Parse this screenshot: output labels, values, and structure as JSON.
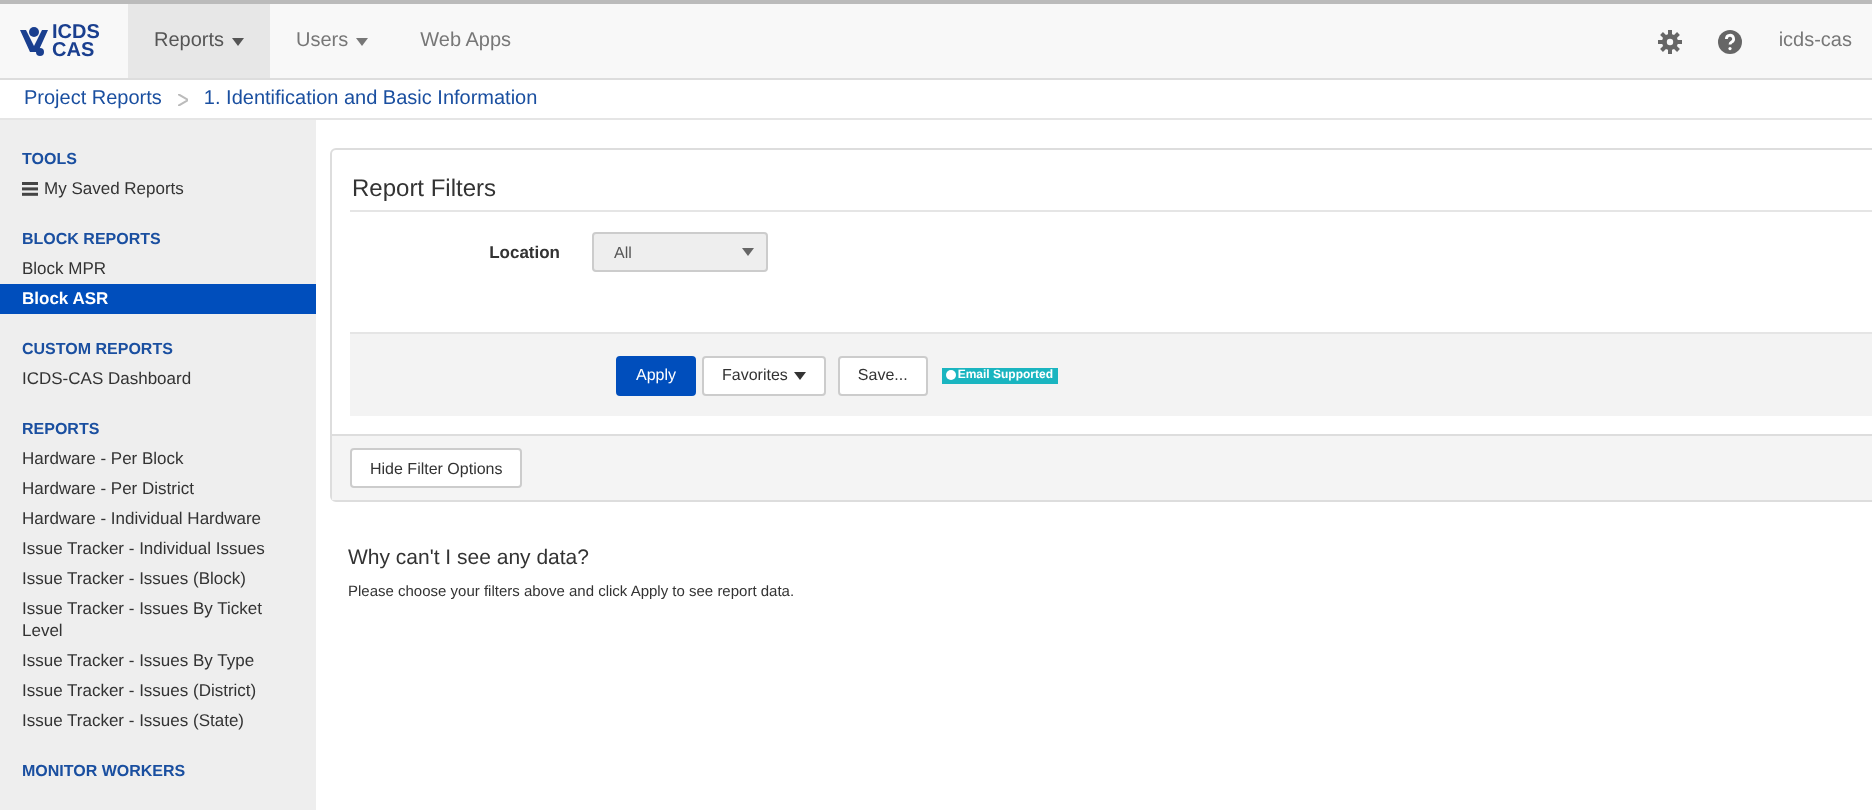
{
  "logo": {
    "lines": [
      "ICDS",
      "CAS"
    ]
  },
  "nav": [
    {
      "label": "Reports",
      "caret": true,
      "selected": true
    },
    {
      "label": "Users",
      "caret": true,
      "selected": false
    },
    {
      "label": "Web Apps",
      "caret": false,
      "selected": false
    }
  ],
  "user": "icds-cas",
  "breadcrumb": [
    "Project Reports",
    "1. Identification and Basic Information"
  ],
  "sidebar": [
    {
      "heading": "TOOLS",
      "items": [
        {
          "label": "My Saved Reports",
          "icon": true,
          "selected": false
        }
      ]
    },
    {
      "heading": "BLOCK REPORTS",
      "items": [
        {
          "label": "Block MPR",
          "selected": false
        },
        {
          "label": "Block ASR",
          "selected": true
        }
      ]
    },
    {
      "heading": "CUSTOM REPORTS",
      "items": [
        {
          "label": "ICDS-CAS Dashboard",
          "selected": false
        }
      ]
    },
    {
      "heading": "REPORTS",
      "items": [
        {
          "label": "Hardware - Per Block",
          "selected": false
        },
        {
          "label": "Hardware - Per District",
          "selected": false
        },
        {
          "label": "Hardware - Individual Hardware",
          "selected": false
        },
        {
          "label": "Issue Tracker - Individual Issues",
          "selected": false
        },
        {
          "label": "Issue Tracker - Issues (Block)",
          "selected": false
        },
        {
          "label": "Issue Tracker - Issues By Ticket Level",
          "selected": false
        },
        {
          "label": "Issue Tracker - Issues By Type",
          "selected": false
        },
        {
          "label": "Issue Tracker - Issues (District)",
          "selected": false
        },
        {
          "label": "Issue Tracker - Issues (State)",
          "selected": false
        }
      ]
    },
    {
      "heading": "MONITOR WORKERS"
    }
  ],
  "filters": {
    "title": "Report Filters",
    "location_label": "Location",
    "location_value": "All",
    "buttons": {
      "apply": "Apply",
      "favorites": "Favorites",
      "save": "Save..."
    },
    "badge": "Email Supported",
    "hide": "Hide Filter Options"
  },
  "notice": {
    "title": "Why can't I see any data?",
    "text": "Please choose your filters above and click Apply to see report data."
  }
}
